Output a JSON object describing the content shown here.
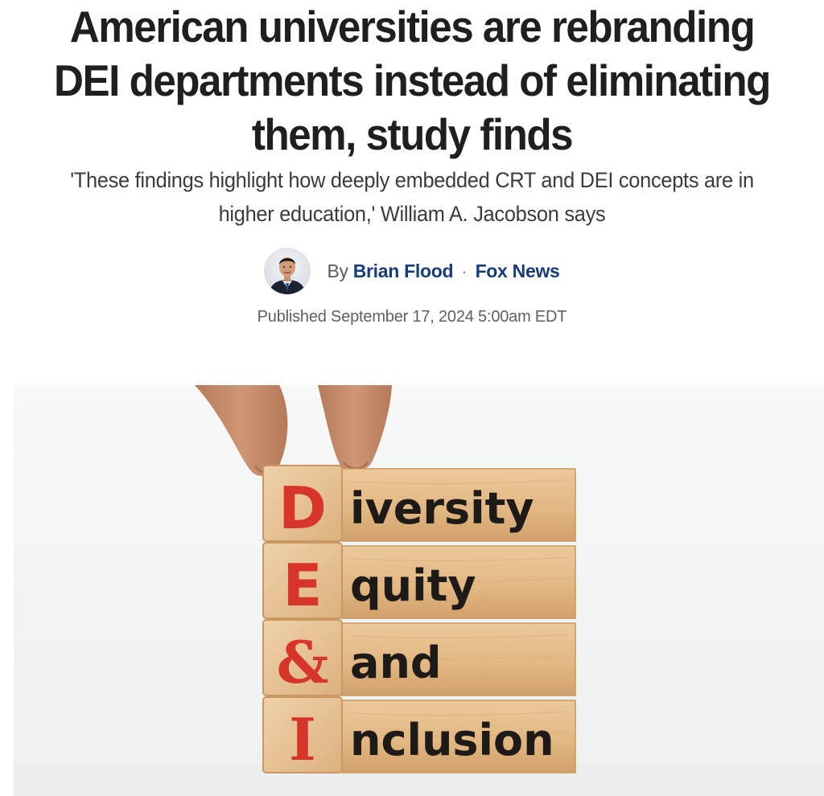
{
  "article": {
    "headline": "American universities are rebranding DEI departments instead of eliminating them, study finds",
    "subheadline": "'These findings highlight how deeply embedded CRT and DEI concepts are in higher education,' William A. Jacobson says",
    "byline": {
      "prefix": "By",
      "author": "Brian Flood",
      "separator": "·",
      "source": "Fox News"
    },
    "published": "Published September 17, 2024 5:00am EDT"
  },
  "hero_image": {
    "blocks": [
      {
        "letter": "D",
        "word": "iversity"
      },
      {
        "letter": "E",
        "word": "quity"
      },
      {
        "letter": "&",
        "word": "and"
      },
      {
        "letter": "I",
        "word": "nclusion"
      }
    ],
    "colors": {
      "letter": "#d8352a",
      "word": "#1e1a17",
      "wood": "#e4bd8e",
      "wood_dark": "#c9975f"
    }
  },
  "colors": {
    "link": "#183c7a",
    "headline": "#1f1f1f"
  }
}
